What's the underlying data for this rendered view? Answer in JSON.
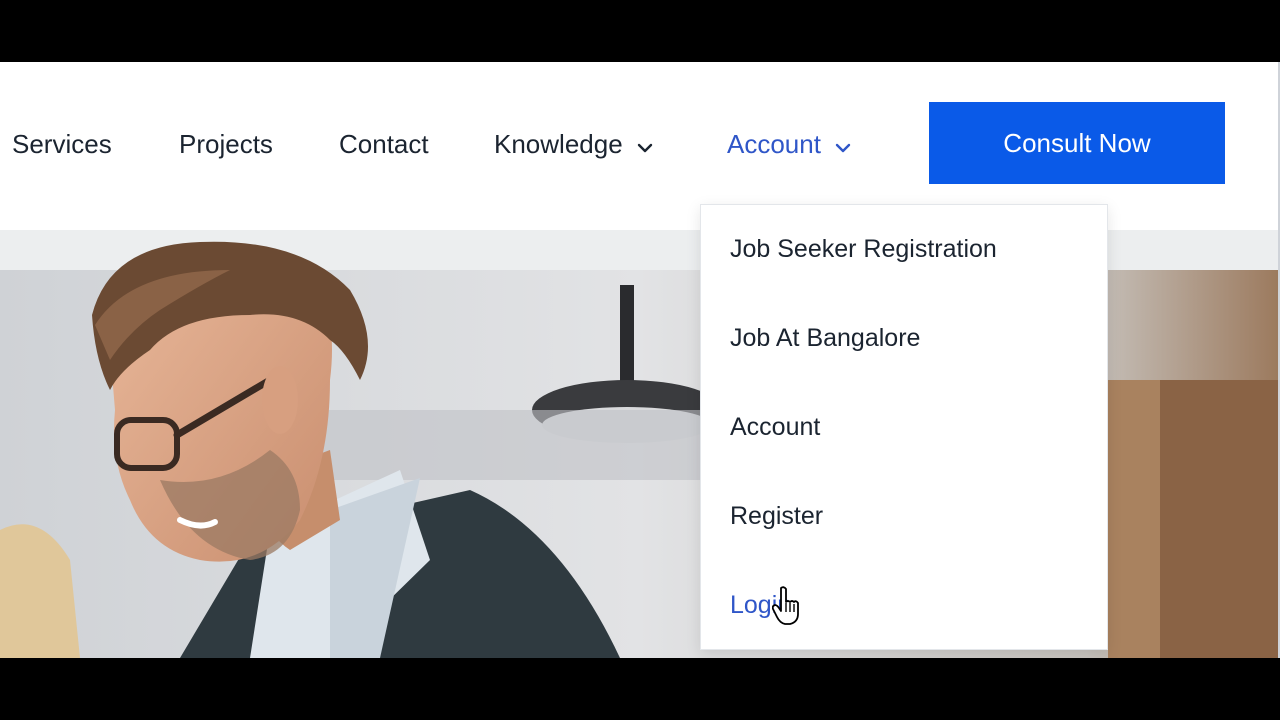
{
  "nav": {
    "items": [
      {
        "label": "Services"
      },
      {
        "label": "Projects"
      },
      {
        "label": "Contact"
      },
      {
        "label": "Knowledge"
      },
      {
        "label": "Account"
      }
    ],
    "cta_label": "Consult Now"
  },
  "account_menu": {
    "items": [
      {
        "label": "Job Seeker Registration"
      },
      {
        "label": "Job At Bangalore"
      },
      {
        "label": "Account"
      },
      {
        "label": "Register"
      },
      {
        "label": "Login"
      }
    ]
  },
  "colors": {
    "accent": "#0a5ae8",
    "active_link": "#2f56c8",
    "text": "#1b2430"
  },
  "icons": [
    "chevron-down-icon",
    "hand-pointer-cursor-icon"
  ]
}
